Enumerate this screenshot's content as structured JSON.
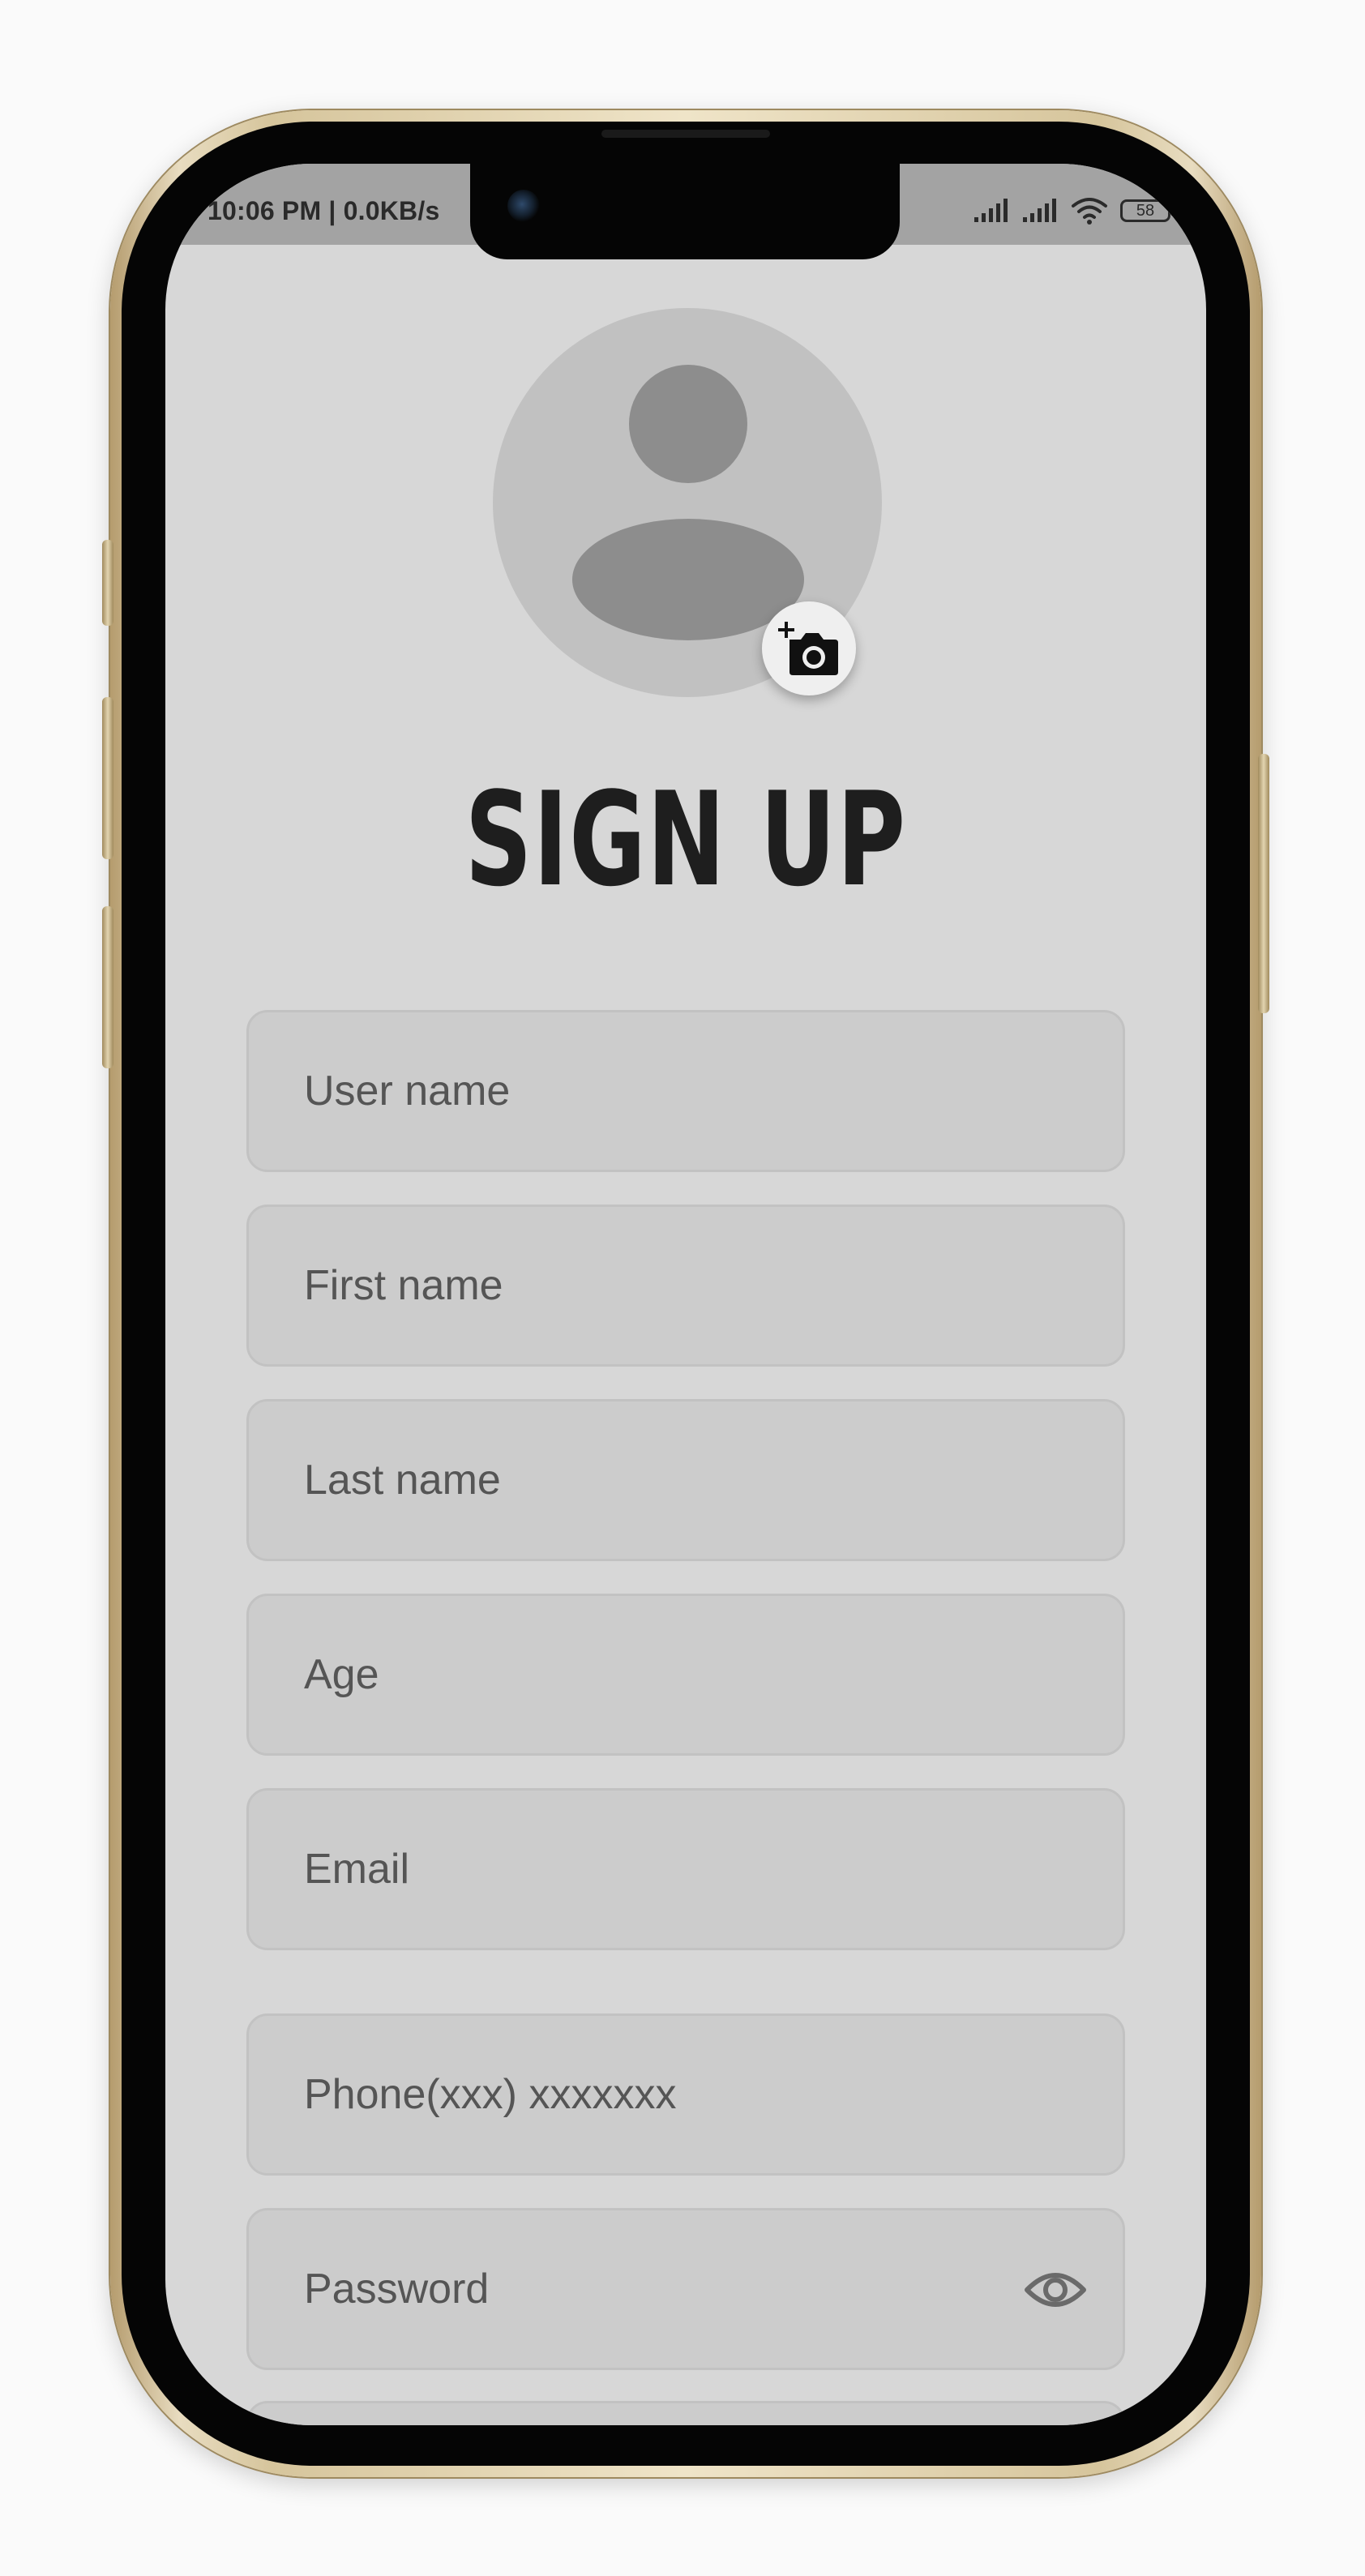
{
  "status_bar": {
    "time": "10:06 PM | 0.0KB/s",
    "battery": "58"
  },
  "profile": {
    "avatar_icon": "person-placeholder",
    "add_photo_icon": "add-a-photo"
  },
  "page": {
    "title": "SIGN UP"
  },
  "form": {
    "fields": [
      {
        "placeholder": "User name"
      },
      {
        "placeholder": "First name"
      },
      {
        "placeholder": "Last name"
      },
      {
        "placeholder": "Age"
      },
      {
        "placeholder": "Email"
      },
      {
        "placeholder": "Phone(xxx) xxxxxxx"
      },
      {
        "placeholder": "Password",
        "trailing_icon": "visibility-eye"
      }
    ]
  },
  "colors": {
    "screen_background": "#d7d7d7",
    "status_bar": "#a3a3a3",
    "field_fill": "#cccccc",
    "placeholder_text": "#555555",
    "title_text": "#1e1e1e"
  }
}
